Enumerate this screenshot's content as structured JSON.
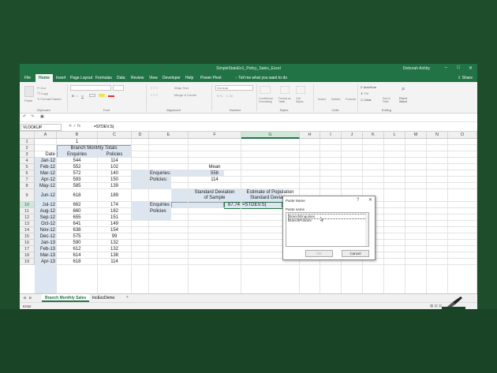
{
  "window": {
    "title": "SimpleStatsEx1_Policy_Sales_Excel",
    "user": "Deborah Ashby",
    "controls": [
      "–",
      "□",
      "✕"
    ]
  },
  "ribbon_tabs": [
    {
      "label": "File"
    },
    {
      "label": "Home",
      "active": true
    },
    {
      "label": "Insert"
    },
    {
      "label": "Page Layout"
    },
    {
      "label": "Formulas"
    },
    {
      "label": "Data"
    },
    {
      "label": "Review"
    },
    {
      "label": "View"
    },
    {
      "label": "Developer"
    },
    {
      "label": "Help"
    },
    {
      "label": "Power Pivot"
    }
  ],
  "tell_me": "Tell me what you want to do",
  "share_label": "Share",
  "ribbon": {
    "clipboard": {
      "paste": "Paste",
      "cut": "Cut",
      "copy": "Copy",
      "format_painter": "Format Painter",
      "group": "Clipboard"
    },
    "font": {
      "group": "Font",
      "bold": "B",
      "italic": "I",
      "underline": "U"
    },
    "alignment": {
      "wrap": "Wrap Text",
      "merge": "Merge & Center",
      "group": "Alignment"
    },
    "number": {
      "format": "General",
      "group": "Number"
    },
    "styles": {
      "conditional": "Conditional Formatting",
      "table": "Format as Table",
      "cell": "Cell Styles",
      "group": "Styles"
    },
    "cells": {
      "insert": "Insert",
      "delete": "Delete",
      "format": "Format",
      "group": "Cells"
    },
    "editing": {
      "autosum": "AutoSum",
      "fill": "Fill",
      "clear": "Clear",
      "sort": "Sort & Filter",
      "find": "Find & Select",
      "group": "Editing"
    }
  },
  "name_box": "VLOOKUP",
  "fx_icons": "✕  ✓  fx",
  "formula": "=STDEV.S(",
  "columns": [
    "A",
    "B",
    "C",
    "D",
    "E",
    "F",
    "G",
    "H",
    "I",
    "J",
    "K",
    "L",
    "M",
    "N",
    "O"
  ],
  "rows": [
    "1",
    "2",
    "3",
    "4",
    "5",
    "6",
    "7",
    "8",
    "9",
    "10",
    "11",
    "12",
    "13",
    "14",
    "15",
    "16",
    "17",
    "18",
    "19"
  ],
  "sheet": {
    "row1_b": "1",
    "branch_header": "Branch Monthly Totals",
    "col_headers": {
      "date": "Date",
      "enquiries": "Enquiries",
      "policies": "Policies"
    },
    "data_rows": [
      {
        "date": "Jan-12",
        "enq": "544",
        "pol": "114"
      },
      {
        "date": "Feb-12",
        "enq": "552",
        "pol": "102"
      },
      {
        "date": "Mar-12",
        "enq": "572",
        "pol": "140"
      },
      {
        "date": "Apr-12",
        "enq": "593",
        "pol": "150"
      },
      {
        "date": "May-12",
        "enq": "585",
        "pol": "139"
      },
      {
        "date": "Jun-12",
        "enq": "618",
        "pol": "189"
      },
      {
        "date": "Jul-12",
        "enq": "662",
        "pol": "174"
      },
      {
        "date": "Aug-12",
        "enq": "660",
        "pol": "182"
      },
      {
        "date": "Sep-12",
        "enq": "655",
        "pol": "151"
      },
      {
        "date": "Oct-12",
        "enq": "641",
        "pol": "149"
      },
      {
        "date": "Nov-12",
        "enq": "638",
        "pol": "154"
      },
      {
        "date": "Dec-12",
        "enq": "575",
        "pol": "99"
      },
      {
        "date": "Jan-13",
        "enq": "590",
        "pol": "132"
      },
      {
        "date": "Feb-13",
        "enq": "612",
        "pol": "132"
      },
      {
        "date": "Mar-13",
        "enq": "614",
        "pol": "138"
      },
      {
        "date": "Apr-13",
        "enq": "618",
        "pol": "114"
      }
    ],
    "mean": {
      "label": "Mean",
      "enq_label": "Enquiries:",
      "enq_value": "558",
      "pol_label": "Policies:",
      "pol_value": "114"
    },
    "stdev": {
      "sample_header_1": "Standard Deviation",
      "sample_header_2": "of Sample",
      "pop_header_1": "Estimate of Population",
      "pop_header_2": "Standard Deviation",
      "enq_label": "Enquiries",
      "pol_label": "Policies",
      "enq_sample": "67.74",
      "enq_pop_edit": "=STDEV.S("
    }
  },
  "dialog": {
    "title": "Paste Name",
    "help": "?",
    "close": "✕",
    "label": "Paste name",
    "items": [
      "BranchEnquiries",
      "BranchPolicies"
    ],
    "ok": "OK",
    "cancel": "Cancel"
  },
  "sheet_tabs": [
    {
      "label": "Branch Monthly Sales",
      "active": true
    },
    {
      "label": "IncExcDemo",
      "active": false
    }
  ],
  "add_sheet": "+",
  "status": "Enter"
}
